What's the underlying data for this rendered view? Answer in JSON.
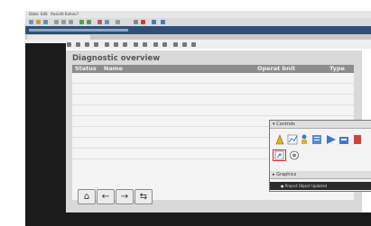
{
  "menu": {
    "items": [
      "Datei",
      "Edit",
      "Ansicht",
      "Extras",
      "?"
    ]
  },
  "screen": {
    "title": "Diagnostic overview",
    "columns": [
      "Status",
      "Name",
      "Operat bnit",
      "Type"
    ]
  },
  "toolbox": {
    "controls_label": "Controls",
    "graphics_label": "Graphics",
    "info_text": "Project Object Updated"
  },
  "nav": {
    "home_symbol": "⌂",
    "back_symbol": "←",
    "forward_symbol": "→",
    "diagnose_symbol": "⇆"
  },
  "colors": {
    "title_bar": "#2f4f7a",
    "highlight": "#d23030",
    "header": "#8c8c8c"
  }
}
